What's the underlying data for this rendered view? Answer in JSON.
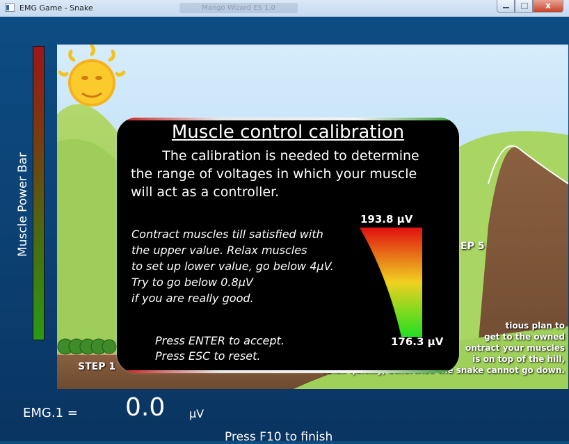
{
  "window": {
    "title": "EMG Game - Snake",
    "ghost_title": "Mango Wizard  ES 1.0",
    "minimize_label": "",
    "maximize_label": "",
    "close_label": "x"
  },
  "power_bar": {
    "label": "Muscle Power Bar",
    "level": 1.0
  },
  "scene": {
    "step_1": "STEP 1",
    "step_5": "EP 5",
    "hint_lines": [
      "tious plan to",
      "get to the owned",
      "ontract your muscles",
      "is on top of the hill,",
      "relax quickly, otherwise the snake cannot go down."
    ]
  },
  "dialog": {
    "title": "Muscle control calibration",
    "description_lines": [
      "The calibration is needed to determine",
      "the range of voltages in which your muscle",
      "will act as a controller."
    ],
    "instruction_lines": [
      "Contract muscles till satisfied with",
      "the upper value. Relax muscles",
      "to set up lower value, go below 4μV.",
      "Try to go below 0.8μV",
      "if you are really good."
    ],
    "range_max": "193.8 μV",
    "range_min": "176.3 μV",
    "key_lines": [
      "Press ENTER to accept.",
      "Press  ESC  to reset."
    ]
  },
  "readout": {
    "label": "EMG.1 =",
    "value": "0.0",
    "unit": "μV",
    "finish_hint": "Press F10 to finish"
  },
  "colors": {
    "background": "#0d4c83",
    "gauge_top": "#e01010",
    "gauge_mid": "#f0d020",
    "gauge_bottom": "#20e020"
  }
}
